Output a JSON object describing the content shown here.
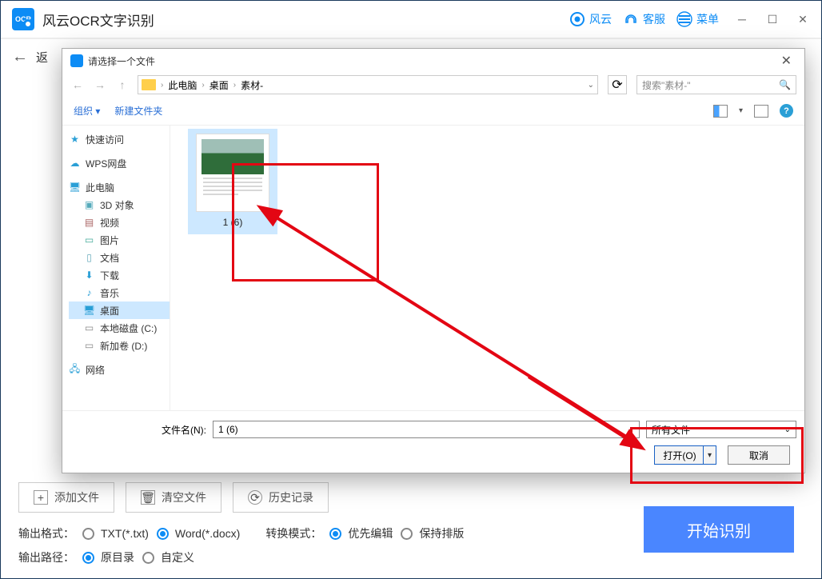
{
  "app": {
    "title": "风云OCR文字识别",
    "header_items": {
      "cloud": "风云",
      "support": "客服",
      "menu": "菜单"
    },
    "back_text": "返"
  },
  "bottom_buttons": {
    "add": "添加文件",
    "clear": "清空文件",
    "history": "历史记录"
  },
  "output_format": {
    "label": "输出格式：",
    "txt": "TXT(*.txt)",
    "word": "Word(*.docx)"
  },
  "convert_mode": {
    "label": "转换模式：",
    "edit": "优先编辑",
    "layout": "保持排版"
  },
  "output_path": {
    "label": "输出路径：",
    "orig": "原目录",
    "custom": "自定义"
  },
  "start": "开始识别",
  "dialog": {
    "title": "请选择一个文件",
    "path": {
      "root": "此电脑",
      "p1": "桌面",
      "p2": "素材-"
    },
    "search_placeholder": "搜索\"素材-\"",
    "organize": "组织",
    "new_folder": "新建文件夹",
    "tree": {
      "quick": "快速访问",
      "wps": "WPS网盘",
      "pc": "此电脑",
      "threed": "3D 对象",
      "video": "视频",
      "pics": "图片",
      "docs": "文档",
      "downloads": "下载",
      "music": "音乐",
      "desktop": "桌面",
      "cdisk": "本地磁盘 (C:)",
      "ddisk": "新加卷 (D:)",
      "network": "网络"
    },
    "thumb_label": "1 (6)",
    "filename_label": "文件名(N):",
    "filename_value": "1 (6)",
    "filetype": "所有文件",
    "open": "打开(O)",
    "cancel": "取消"
  }
}
